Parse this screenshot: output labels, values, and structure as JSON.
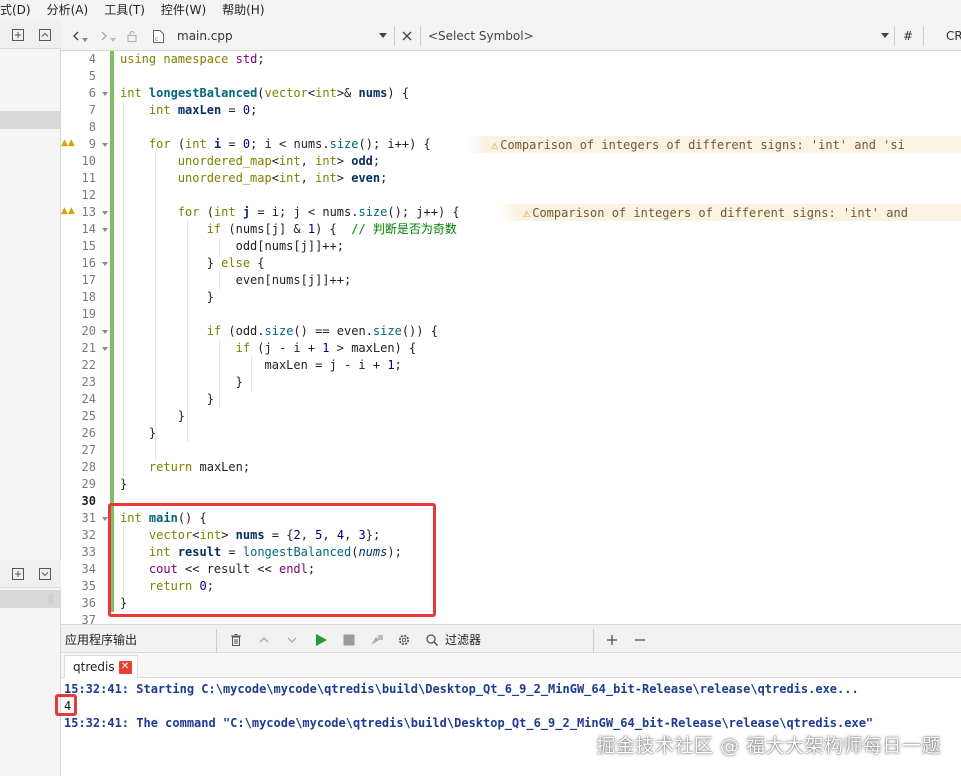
{
  "menubar": {
    "items": [
      "式(D)",
      "分析(A)",
      "工具(T)",
      "控件(W)",
      "帮助(H)"
    ]
  },
  "editor_toolbar": {
    "file_name": "main.cpp",
    "symbol_placeholder": "<Select Symbol>",
    "hash": "#",
    "encoding": "CR"
  },
  "code_lines": [
    {
      "n": "4",
      "html": "<span class=\"kw\">using</span> <span class=\"kw\">namespace</span> <span class=\"std\">std</span>;"
    },
    {
      "n": "5",
      "html": ""
    },
    {
      "n": "6",
      "html": "<span class=\"ty\">int</span> <span class=\"fn\">longestBalanced</span>(<span class=\"ty\">vector</span>&lt;<span class=\"ty\">int</span>&gt;&amp; <span class=\"var\">nums</span>) {"
    },
    {
      "n": "7",
      "html": "    <span class=\"ty\">int</span> <span class=\"var\">maxLen</span> = <span class=\"num\">0</span>;"
    },
    {
      "n": "8",
      "html": ""
    },
    {
      "n": "9",
      "html": "    <span class=\"kw\">for</span> (<span class=\"ty\">int</span> <span class=\"var\">i</span> = <span class=\"num\">0</span>; i &lt; nums.<span class=\"fn\" style=\"font-weight:normal\">size</span>(); i++) {"
    },
    {
      "n": "10",
      "html": "        <span class=\"ty\">unordered_map</span>&lt;<span class=\"ty\">int</span>, <span class=\"ty\">int</span>&gt; <span class=\"var\">odd</span>;"
    },
    {
      "n": "11",
      "html": "        <span class=\"ty\">unordered_map</span>&lt;<span class=\"ty\">int</span>, <span class=\"ty\">int</span>&gt; <span class=\"var\">even</span>;"
    },
    {
      "n": "12",
      "html": ""
    },
    {
      "n": "13",
      "html": "        <span class=\"kw\">for</span> (<span class=\"ty\">int</span> <span class=\"var\">j</span> = i; j &lt; nums.<span class=\"fn\" style=\"font-weight:normal\">size</span>(); j++) {"
    },
    {
      "n": "14",
      "html": "            <span class=\"kw\">if</span> (nums[j] &amp; <span class=\"num\">1</span>) {  <span class=\"cm\">// 判断是否为奇数</span>"
    },
    {
      "n": "15",
      "html": "                odd[nums[j]]++;"
    },
    {
      "n": "16",
      "html": "            } <span class=\"kw\">else</span> {"
    },
    {
      "n": "17",
      "html": "                even[nums[j]]++;"
    },
    {
      "n": "18",
      "html": "            }"
    },
    {
      "n": "19",
      "html": ""
    },
    {
      "n": "20",
      "html": "            <span class=\"kw\">if</span> (odd.<span class=\"fn\" style=\"font-weight:normal\">size</span>() == even.<span class=\"fn\" style=\"font-weight:normal\">size</span>()) {"
    },
    {
      "n": "21",
      "html": "                <span class=\"kw\">if</span> (j - i + <span class=\"num\">1</span> &gt; maxLen) {"
    },
    {
      "n": "22",
      "html": "                    maxLen = j - i + <span class=\"num\">1</span>;"
    },
    {
      "n": "23",
      "html": "                }"
    },
    {
      "n": "24",
      "html": "            }"
    },
    {
      "n": "25",
      "html": "        }"
    },
    {
      "n": "26",
      "html": "    }"
    },
    {
      "n": "27",
      "html": ""
    },
    {
      "n": "28",
      "html": "    <span class=\"kw\">return</span> maxLen;"
    },
    {
      "n": "29",
      "html": "}"
    },
    {
      "n": "30",
      "html": ""
    },
    {
      "n": "31",
      "html": "<span class=\"ty\">int</span> <span class=\"fn\">main</span>() {"
    },
    {
      "n": "32",
      "html": "    <span class=\"ty\">vector</span>&lt;<span class=\"ty\">int</span>&gt; <span class=\"var\">nums</span> = {<span class=\"num\">2</span>, <span class=\"num\">5</span>, <span class=\"num\">4</span>, <span class=\"num\">3</span>};"
    },
    {
      "n": "33",
      "html": "    <span class=\"ty\">int</span> <span class=\"var\">result</span> = <span class=\"fn\" style=\"font-weight:normal\">longestBalanced</span>(<span class=\"it\">nums</span>);"
    },
    {
      "n": "34",
      "html": "    <span class=\"std\">cout</span> &lt;&lt; result &lt;&lt; <span class=\"std\">endl</span>;"
    },
    {
      "n": "35",
      "html": "    <span class=\"kw\">return</span> <span class=\"num\">0</span>;"
    },
    {
      "n": "36",
      "html": "}"
    },
    {
      "n": "37",
      "html": ""
    }
  ],
  "warnings": [
    {
      "line": "9",
      "text": "Comparison of integers of different signs: 'int' and 'si"
    },
    {
      "line": "13",
      "text": "Comparison of integers of different signs: 'int' and"
    }
  ],
  "output_panel": {
    "title": "应用程序输出",
    "filter_label": "过滤器",
    "tab_label": "qtredis",
    "lines": [
      "15:32:41: Starting C:\\mycode\\mycode\\qtredis\\build\\Desktop_Qt_6_9_2_MinGW_64_bit-Release\\release\\qtredis.exe...",
      "4",
      "15:32:41: The command \"C:\\mycode\\mycode\\qtredis\\build\\Desktop_Qt_6_9_2_MinGW_64_bit-Release\\release\\qtredis.exe\""
    ]
  },
  "watermark": "掘金技术社区 @ 福大大架构师每日一题",
  "colors": {
    "highlight_box": "#e53a3a",
    "modified_bar": "#7fbf5f",
    "output_text": "#1d3b91"
  },
  "icons": [
    "back-icon",
    "forward-icon",
    "lock-icon",
    "file-icon",
    "close-icon",
    "trash-icon",
    "up-icon",
    "down-icon",
    "run-icon",
    "stop-icon",
    "build-icon",
    "gear-icon",
    "search-icon",
    "plus-icon",
    "minus-icon"
  ]
}
